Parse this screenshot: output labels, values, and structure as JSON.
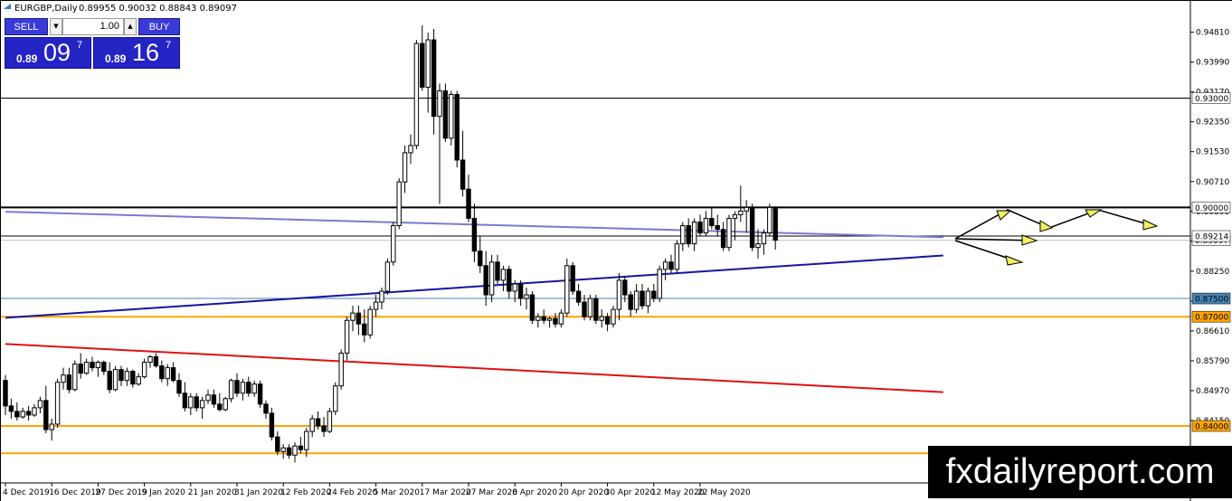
{
  "header": {
    "symbol": "EURGBP,Daily",
    "ohlc": "0.89955 0.90032 0.88843 0.89097"
  },
  "trade_panel": {
    "sell_label": "SELL",
    "buy_label": "BUY",
    "volume": "1.00",
    "bid_small": "0.89",
    "bid_big": "09",
    "bid_sup": "7",
    "ask_small": "0.89",
    "ask_big": "16",
    "ask_sup": "7"
  },
  "watermark": "fxdailyreport.com",
  "colors": {
    "bull_body": "#ffffff",
    "bear_body": "#000000",
    "orange_line": "#ffa500",
    "red_line": "#e01010",
    "blue_line": "#1515a0",
    "purple_line": "#7a7ad0",
    "steel_line": "#4682b4",
    "arrow_fill": "#f0f060"
  },
  "chart_data": {
    "type": "candlestick",
    "symbol": "EURGBP",
    "timeframe": "Daily",
    "y_ticks": [
      "0.94810",
      "0.93990",
      "0.93170",
      "0.92350",
      "0.91530",
      "0.90710",
      "0.89890",
      "0.89070",
      "0.88250",
      "0.87430",
      "0.86610",
      "0.85790",
      "0.84970",
      "0.84150"
    ],
    "x_ticks": [
      {
        "label": "4 Dec 2019",
        "index": 0
      },
      {
        "label": "16 Dec 2019",
        "index": 8
      },
      {
        "label": "27 Dec 2019",
        "index": 16
      },
      {
        "label": "9 Jan 2020",
        "index": 24
      },
      {
        "label": "21 Jan 2020",
        "index": 32
      },
      {
        "label": "31 Jan 2020",
        "index": 40
      },
      {
        "label": "12 Feb 2020",
        "index": 48
      },
      {
        "label": "24 Feb 2020",
        "index": 56
      },
      {
        "label": "5 Mar 2020",
        "index": 64
      },
      {
        "label": "17 Mar 2020",
        "index": 72
      },
      {
        "label": "27 Mar 2020",
        "index": 80
      },
      {
        "label": "8 Apr 2020",
        "index": 88
      },
      {
        "label": "20 Apr 2020",
        "index": 96
      },
      {
        "label": "30 Apr 2020",
        "index": 104
      },
      {
        "label": "12 May 2020",
        "index": 112
      },
      {
        "label": "22 May 2020",
        "index": 120
      }
    ],
    "horizontal_levels": [
      {
        "label": "0.93000",
        "value": 0.93,
        "color": "#000000",
        "width": 1
      },
      {
        "label": "0.90000",
        "value": 0.9,
        "color": "#000000",
        "width": 2
      },
      {
        "label": "0.87500",
        "value": 0.875,
        "color": "#4682b4",
        "width": 1
      },
      {
        "label": "0.87000",
        "value": 0.87,
        "color": "#ffa500",
        "width": 2
      },
      {
        "label": "0.84000",
        "value": 0.84,
        "color": "#ffa500",
        "width": 2
      },
      {
        "value": 0.8325,
        "color": "#ffa500",
        "width": 2
      }
    ],
    "current_price_label": "0.89214",
    "current_price": 0.89214,
    "bid_label": "0.89097",
    "bid": 0.89097,
    "trendlines": [
      {
        "name": "blue-support",
        "color": "#1515a0",
        "width": 2,
        "from": [
          0,
          0.8697
        ],
        "to": [
          162,
          0.8868
        ]
      },
      {
        "name": "purple-line",
        "color": "#7a7ad0",
        "width": 2,
        "from": [
          0,
          0.8988
        ],
        "to": [
          162,
          0.8918
        ]
      },
      {
        "name": "red-line",
        "color": "#e01010",
        "width": 2,
        "from": [
          0,
          0.8625
        ],
        "to": [
          162,
          0.8493
        ]
      }
    ],
    "ohlc": [
      [
        0.8525,
        0.854,
        0.843,
        0.8455
      ],
      [
        0.8455,
        0.8475,
        0.842,
        0.844
      ],
      [
        0.844,
        0.8465,
        0.8415,
        0.8425
      ],
      [
        0.8425,
        0.845,
        0.842,
        0.844
      ],
      [
        0.844,
        0.8455,
        0.8415,
        0.843
      ],
      [
        0.843,
        0.846,
        0.8425,
        0.845
      ],
      [
        0.845,
        0.848,
        0.8435,
        0.847
      ],
      [
        0.847,
        0.851,
        0.838,
        0.839
      ],
      [
        0.839,
        0.842,
        0.836,
        0.8405
      ],
      [
        0.8405,
        0.853,
        0.8395,
        0.852
      ],
      [
        0.852,
        0.856,
        0.85,
        0.854
      ],
      [
        0.854,
        0.856,
        0.849,
        0.85
      ],
      [
        0.85,
        0.858,
        0.8495,
        0.857
      ],
      [
        0.857,
        0.86,
        0.853,
        0.8545
      ],
      [
        0.8545,
        0.8585,
        0.854,
        0.8575
      ],
      [
        0.8575,
        0.859,
        0.855,
        0.856
      ],
      [
        0.856,
        0.858,
        0.8535,
        0.8575
      ],
      [
        0.8575,
        0.858,
        0.854,
        0.855
      ],
      [
        0.855,
        0.8575,
        0.849,
        0.85
      ],
      [
        0.85,
        0.8565,
        0.8495,
        0.8555
      ],
      [
        0.8555,
        0.8565,
        0.851,
        0.8525
      ],
      [
        0.8525,
        0.856,
        0.851,
        0.855
      ],
      [
        0.855,
        0.8555,
        0.8505,
        0.8515
      ],
      [
        0.8515,
        0.8545,
        0.851,
        0.8535
      ],
      [
        0.8535,
        0.8585,
        0.853,
        0.8575
      ],
      [
        0.8575,
        0.8595,
        0.856,
        0.859
      ],
      [
        0.859,
        0.86,
        0.856,
        0.8565
      ],
      [
        0.8565,
        0.858,
        0.852,
        0.853
      ],
      [
        0.853,
        0.857,
        0.851,
        0.856
      ],
      [
        0.856,
        0.8575,
        0.852,
        0.8525
      ],
      [
        0.8525,
        0.8545,
        0.848,
        0.849
      ],
      [
        0.849,
        0.852,
        0.844,
        0.845
      ],
      [
        0.845,
        0.849,
        0.843,
        0.848
      ],
      [
        0.848,
        0.849,
        0.844,
        0.845
      ],
      [
        0.845,
        0.848,
        0.842,
        0.847
      ],
      [
        0.847,
        0.85,
        0.846,
        0.8485
      ],
      [
        0.8485,
        0.85,
        0.845,
        0.846
      ],
      [
        0.846,
        0.849,
        0.844,
        0.8445
      ],
      [
        0.8445,
        0.848,
        0.844,
        0.8475
      ],
      [
        0.8475,
        0.853,
        0.8465,
        0.8525
      ],
      [
        0.8525,
        0.8545,
        0.848,
        0.849
      ],
      [
        0.849,
        0.853,
        0.847,
        0.852
      ],
      [
        0.852,
        0.8535,
        0.848,
        0.849
      ],
      [
        0.849,
        0.8525,
        0.848,
        0.8515
      ],
      [
        0.8515,
        0.8525,
        0.845,
        0.846
      ],
      [
        0.846,
        0.847,
        0.842,
        0.8435
      ],
      [
        0.8435,
        0.845,
        0.836,
        0.837
      ],
      [
        0.837,
        0.8385,
        0.832,
        0.833
      ],
      [
        0.833,
        0.835,
        0.831,
        0.834
      ],
      [
        0.834,
        0.835,
        0.831,
        0.832
      ],
      [
        0.832,
        0.8355,
        0.83,
        0.8345
      ],
      [
        0.8345,
        0.837,
        0.8325,
        0.8335
      ],
      [
        0.8335,
        0.8395,
        0.8315,
        0.8385
      ],
      [
        0.8385,
        0.843,
        0.837,
        0.842
      ],
      [
        0.842,
        0.844,
        0.839,
        0.84
      ],
      [
        0.84,
        0.8425,
        0.837,
        0.8385
      ],
      [
        0.8385,
        0.845,
        0.838,
        0.844
      ],
      [
        0.844,
        0.852,
        0.843,
        0.851
      ],
      [
        0.851,
        0.861,
        0.85,
        0.86
      ],
      [
        0.86,
        0.87,
        0.858,
        0.869
      ],
      [
        0.869,
        0.873,
        0.866,
        0.871
      ],
      [
        0.871,
        0.873,
        0.865,
        0.868
      ],
      [
        0.868,
        0.872,
        0.863,
        0.865
      ],
      [
        0.865,
        0.873,
        0.864,
        0.872
      ],
      [
        0.872,
        0.876,
        0.87,
        0.874
      ],
      [
        0.874,
        0.878,
        0.872,
        0.877
      ],
      [
        0.877,
        0.886,
        0.876,
        0.885
      ],
      [
        0.885,
        0.896,
        0.884,
        0.895
      ],
      [
        0.895,
        0.908,
        0.894,
        0.907
      ],
      [
        0.907,
        0.917,
        0.904,
        0.915
      ],
      [
        0.915,
        0.92,
        0.912,
        0.917
      ],
      [
        0.917,
        0.946,
        0.916,
        0.945
      ],
      [
        0.945,
        0.95,
        0.932,
        0.933
      ],
      [
        0.933,
        0.948,
        0.926,
        0.946
      ],
      [
        0.946,
        0.949,
        0.92,
        0.925
      ],
      [
        0.925,
        0.934,
        0.901,
        0.932
      ],
      [
        0.932,
        0.934,
        0.918,
        0.919
      ],
      [
        0.919,
        0.932,
        0.917,
        0.931
      ],
      [
        0.931,
        0.932,
        0.911,
        0.913
      ],
      [
        0.913,
        0.921,
        0.903,
        0.905
      ],
      [
        0.905,
        0.909,
        0.896,
        0.897
      ],
      [
        0.897,
        0.901,
        0.885,
        0.888
      ],
      [
        0.888,
        0.892,
        0.882,
        0.884
      ],
      [
        0.884,
        0.888,
        0.873,
        0.876
      ],
      [
        0.876,
        0.887,
        0.874,
        0.885
      ],
      [
        0.885,
        0.887,
        0.879,
        0.88
      ],
      [
        0.88,
        0.884,
        0.877,
        0.883
      ],
      [
        0.883,
        0.884,
        0.875,
        0.877
      ],
      [
        0.877,
        0.88,
        0.874,
        0.879
      ],
      [
        0.879,
        0.88,
        0.873,
        0.875
      ],
      [
        0.875,
        0.878,
        0.872,
        0.876
      ],
      [
        0.876,
        0.877,
        0.868,
        0.869
      ],
      [
        0.869,
        0.871,
        0.867,
        0.87
      ],
      [
        0.87,
        0.872,
        0.868,
        0.869
      ],
      [
        0.869,
        0.87,
        0.867,
        0.8695
      ],
      [
        0.8695,
        0.871,
        0.867,
        0.868
      ],
      [
        0.868,
        0.872,
        0.867,
        0.871
      ],
      [
        0.871,
        0.886,
        0.87,
        0.884
      ],
      [
        0.884,
        0.885,
        0.876,
        0.877
      ],
      [
        0.877,
        0.879,
        0.873,
        0.874
      ],
      [
        0.874,
        0.876,
        0.869,
        0.87
      ],
      [
        0.87,
        0.876,
        0.869,
        0.875
      ],
      [
        0.875,
        0.876,
        0.868,
        0.869
      ],
      [
        0.869,
        0.872,
        0.867,
        0.87
      ],
      [
        0.87,
        0.871,
        0.866,
        0.868
      ],
      [
        0.868,
        0.873,
        0.867,
        0.872
      ],
      [
        0.872,
        0.882,
        0.869,
        0.88
      ],
      [
        0.88,
        0.881,
        0.874,
        0.876
      ],
      [
        0.876,
        0.877,
        0.87,
        0.872
      ],
      [
        0.872,
        0.879,
        0.871,
        0.877
      ],
      [
        0.877,
        0.879,
        0.872,
        0.873
      ],
      [
        0.873,
        0.878,
        0.871,
        0.877
      ],
      [
        0.877,
        0.879,
        0.874,
        0.875
      ],
      [
        0.875,
        0.884,
        0.874,
        0.883
      ],
      [
        0.883,
        0.886,
        0.88,
        0.885
      ],
      [
        0.885,
        0.887,
        0.882,
        0.883
      ],
      [
        0.883,
        0.891,
        0.882,
        0.89
      ],
      [
        0.89,
        0.896,
        0.888,
        0.895
      ],
      [
        0.895,
        0.897,
        0.889,
        0.89
      ],
      [
        0.89,
        0.897,
        0.888,
        0.896
      ],
      [
        0.896,
        0.898,
        0.892,
        0.893
      ],
      [
        0.893,
        0.899,
        0.892,
        0.897
      ],
      [
        0.897,
        0.9,
        0.894,
        0.895
      ],
      [
        0.895,
        0.898,
        0.892,
        0.894
      ],
      [
        0.894,
        0.896,
        0.888,
        0.889
      ],
      [
        0.889,
        0.898,
        0.888,
        0.897
      ],
      [
        0.897,
        0.899,
        0.891,
        0.898
      ],
      [
        0.898,
        0.906,
        0.896,
        0.899
      ],
      [
        0.899,
        0.902,
        0.893,
        0.9
      ],
      [
        0.9,
        0.901,
        0.888,
        0.889
      ],
      [
        0.889,
        0.894,
        0.886,
        0.89
      ],
      [
        0.89,
        0.894,
        0.887,
        0.893
      ],
      [
        0.893,
        0.901,
        0.892,
        0.9
      ],
      [
        0.8996,
        0.9003,
        0.8884,
        0.891
      ]
    ]
  }
}
